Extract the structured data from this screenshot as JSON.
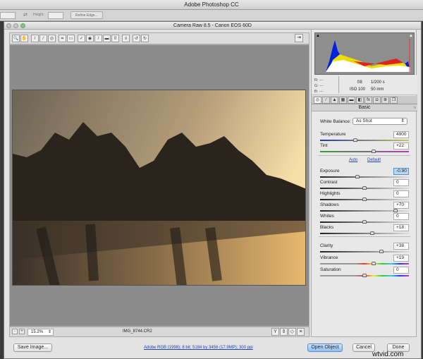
{
  "app_title": "Adobe Photoshop CC",
  "options_bar": {
    "height_label": "Height:",
    "refine_edge": "Refine Edge..."
  },
  "dialog": {
    "title": "Camera Raw 8.5  -  Canon EOS 60D"
  },
  "preview": {
    "zoom": "15.2%",
    "filename": "IMG_8744.CR2"
  },
  "info": {
    "r": "R:",
    "g": "G:",
    "b": "B:",
    "dash": "---",
    "aperture": "f/8",
    "shutter": "1/200 s",
    "iso": "ISO 100",
    "focal": "50 mm"
  },
  "panel": {
    "title": "Basic",
    "wb_label": "White Balance:",
    "wb_value": "As Shot",
    "auto": "Auto",
    "default": "Default"
  },
  "sliders": [
    {
      "label": "Temperature",
      "value": "4900",
      "pos": 0.4,
      "track": "temp",
      "section": 0
    },
    {
      "label": "Tint",
      "value": "+22",
      "pos": 0.6,
      "track": "tint",
      "section": 0
    },
    {
      "label": "Exposure",
      "value": "-0.90",
      "pos": 0.42,
      "track": "gray",
      "section": 1,
      "active": true
    },
    {
      "label": "Contrast",
      "value": "0",
      "pos": 0.5,
      "track": "gray",
      "section": 1
    },
    {
      "label": "Highlights",
      "value": "0",
      "pos": 0.5,
      "track": "gray",
      "section": 1
    },
    {
      "label": "Shadows",
      "value": "+70",
      "pos": 0.85,
      "track": "gray",
      "section": 1
    },
    {
      "label": "Whites",
      "value": "0",
      "pos": 0.5,
      "track": "gray",
      "section": 1
    },
    {
      "label": "Blacks",
      "value": "+18",
      "pos": 0.59,
      "track": "gray",
      "section": 1
    },
    {
      "label": "Clarity",
      "value": "+38",
      "pos": 0.69,
      "track": "gray",
      "section": 2
    },
    {
      "label": "Vibrance",
      "value": "+19",
      "pos": 0.6,
      "track": "rainbow",
      "section": 2
    },
    {
      "label": "Saturation",
      "value": "0",
      "pos": 0.5,
      "track": "rainbow",
      "section": 2
    }
  ],
  "footer": {
    "save": "Save Image...",
    "workflow": "Adobe RGB (1998); 8 bit; 5184 by 3456 (17.9MP); 300 ppi",
    "open": "Open Object",
    "cancel": "Cancel",
    "done": "Done",
    "watermark": "wtvid.com"
  },
  "tools": [
    "zoom-icon",
    "hand-icon",
    "white-balance-icon",
    "color-sampler-icon",
    "target-adjust-icon",
    "crop-icon",
    "straighten-icon",
    "spot-removal-icon",
    "red-eye-icon",
    "adjustment-brush-icon",
    "graduated-filter-icon",
    "radial-filter-icon",
    "preferences-icon",
    "rotate-ccw-icon",
    "rotate-cw-icon"
  ],
  "tabs": [
    "basic-icon",
    "tone-curve-icon",
    "detail-icon",
    "hsl-icon",
    "split-toning-icon",
    "lens-icon",
    "effects-icon",
    "camera-calibration-icon",
    "presets-icon",
    "snapshots-icon"
  ]
}
